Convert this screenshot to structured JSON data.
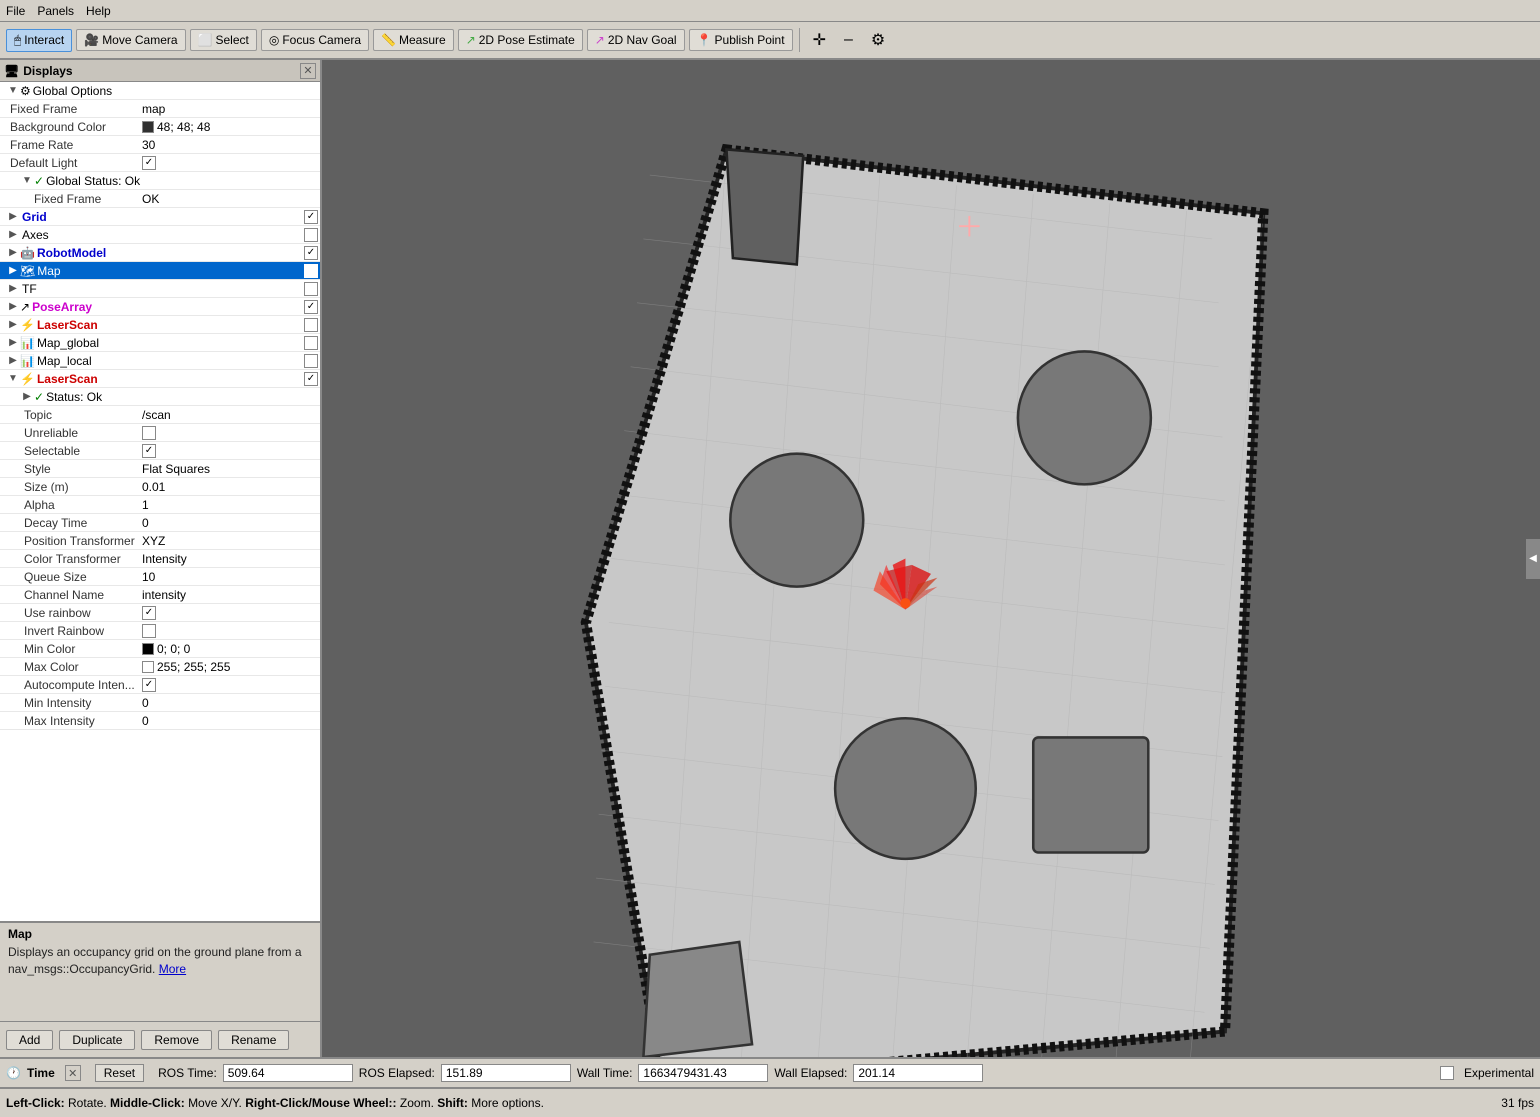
{
  "menubar": {
    "items": [
      "File",
      "Panels",
      "Help"
    ]
  },
  "toolbar": {
    "buttons": [
      {
        "id": "interact",
        "label": "Interact",
        "icon": "🖱",
        "active": true
      },
      {
        "id": "move-camera",
        "label": "Move Camera",
        "icon": "🎥",
        "active": false
      },
      {
        "id": "select",
        "label": "Select",
        "icon": "⬜",
        "active": false
      },
      {
        "id": "focus-camera",
        "label": "Focus Camera",
        "icon": "◎",
        "active": false
      },
      {
        "id": "measure",
        "label": "Measure",
        "icon": "📏",
        "active": false
      },
      {
        "id": "pose-estimate",
        "label": "2D Pose Estimate",
        "icon": "→",
        "active": false
      },
      {
        "id": "nav-goal",
        "label": "2D Nav Goal",
        "icon": "→",
        "active": false
      },
      {
        "id": "publish-point",
        "label": "Publish Point",
        "icon": "📍",
        "active": false
      }
    ]
  },
  "displays": {
    "header_title": "Displays",
    "tree": [
      {
        "id": "global-options",
        "label": "Global Options",
        "icon": "⚙",
        "level": 0,
        "expanded": true,
        "checkable": false
      },
      {
        "id": "fixed-frame-label",
        "label": "Fixed Frame",
        "value": "map",
        "level": 1,
        "is_prop": true
      },
      {
        "id": "bg-color-label",
        "label": "Background Color",
        "value": "48; 48; 48",
        "color": "dark",
        "level": 1,
        "is_prop": true
      },
      {
        "id": "frame-rate-label",
        "label": "Frame Rate",
        "value": "30",
        "level": 1,
        "is_prop": true
      },
      {
        "id": "default-light-label",
        "label": "Default Light",
        "value": "",
        "checked": true,
        "level": 1,
        "is_prop": true
      },
      {
        "id": "global-status",
        "label": "Global Status: Ok",
        "icon": "✓",
        "level": 1,
        "expanded": true,
        "checkable": false
      },
      {
        "id": "fixed-frame-status",
        "label": "Fixed Frame",
        "value": "OK",
        "level": 2,
        "is_prop": true
      },
      {
        "id": "grid",
        "label": "Grid",
        "level": 0,
        "expanded": false,
        "checkable": true,
        "checked": true,
        "color": "blue"
      },
      {
        "id": "axes",
        "label": "Axes",
        "level": 0,
        "expanded": false,
        "checkable": true,
        "checked": false
      },
      {
        "id": "robot-model",
        "label": "RobotModel",
        "level": 0,
        "expanded": false,
        "checkable": true,
        "checked": true,
        "color": "blue"
      },
      {
        "id": "map",
        "label": "Map",
        "level": 0,
        "expanded": false,
        "checkable": true,
        "checked": true,
        "selected": true
      },
      {
        "id": "tf",
        "label": "TF",
        "level": 0,
        "expanded": false,
        "checkable": true,
        "checked": false
      },
      {
        "id": "pose-array",
        "label": "PoseArray",
        "level": 0,
        "expanded": false,
        "checkable": true,
        "checked": true,
        "color": "pink"
      },
      {
        "id": "laser-scan-1",
        "label": "LaserScan",
        "level": 0,
        "expanded": false,
        "checkable": true,
        "checked": false,
        "color": "red"
      },
      {
        "id": "map-global",
        "label": "Map_global",
        "level": 0,
        "expanded": false,
        "checkable": true,
        "checked": false
      },
      {
        "id": "map-local",
        "label": "Map_local",
        "level": 0,
        "expanded": false,
        "checkable": true,
        "checked": false
      },
      {
        "id": "laser-scan-2",
        "label": "LaserScan",
        "level": 0,
        "expanded": true,
        "checkable": true,
        "checked": true,
        "color": "red"
      },
      {
        "id": "status-ok",
        "label": "Status: Ok",
        "icon": "✓",
        "level": 1,
        "expanded": false,
        "checkable": false
      },
      {
        "id": "topic-prop",
        "label": "Topic",
        "value": "/scan",
        "level": 1,
        "is_prop": true
      },
      {
        "id": "unreliable-prop",
        "label": "Unreliable",
        "value": "",
        "checked": false,
        "level": 1,
        "is_prop": true
      },
      {
        "id": "selectable-prop",
        "label": "Selectable",
        "value": "",
        "checked": true,
        "level": 1,
        "is_prop": true
      },
      {
        "id": "style-prop",
        "label": "Style",
        "value": "Flat Squares",
        "level": 1,
        "is_prop": true
      },
      {
        "id": "size-prop",
        "label": "Size (m)",
        "value": "0.01",
        "level": 1,
        "is_prop": true
      },
      {
        "id": "alpha-prop",
        "label": "Alpha",
        "value": "1",
        "level": 1,
        "is_prop": true
      },
      {
        "id": "decay-prop",
        "label": "Decay Time",
        "value": "0",
        "level": 1,
        "is_prop": true
      },
      {
        "id": "pos-transformer-prop",
        "label": "Position Transformer",
        "value": "XYZ",
        "level": 1,
        "is_prop": true
      },
      {
        "id": "color-transformer-prop",
        "label": "Color Transformer",
        "value": "Intensity",
        "level": 1,
        "is_prop": true
      },
      {
        "id": "queue-size-prop",
        "label": "Queue Size",
        "value": "10",
        "level": 1,
        "is_prop": true
      },
      {
        "id": "channel-name-prop",
        "label": "Channel Name",
        "value": "intensity",
        "level": 1,
        "is_prop": true
      },
      {
        "id": "use-rainbow-prop",
        "label": "Use rainbow",
        "value": "",
        "checked": true,
        "level": 1,
        "is_prop": true
      },
      {
        "id": "invert-rainbow-prop",
        "label": "Invert Rainbow",
        "value": "",
        "checked": false,
        "level": 1,
        "is_prop": true
      },
      {
        "id": "min-color-prop",
        "label": "Min Color",
        "value": "0; 0; 0",
        "color_box": "black",
        "level": 1,
        "is_prop": true
      },
      {
        "id": "max-color-prop",
        "label": "Max Color",
        "value": "255; 255; 255",
        "color_box": "white",
        "level": 1,
        "is_prop": true
      },
      {
        "id": "autocompute-prop",
        "label": "Autocompute Inten...",
        "value": "",
        "checked": true,
        "level": 1,
        "is_prop": true
      },
      {
        "id": "min-intensity-prop",
        "label": "Min Intensity",
        "value": "0",
        "level": 1,
        "is_prop": true
      },
      {
        "id": "max-intensity-prop",
        "label": "Max Intensity",
        "value": "0",
        "level": 1,
        "is_prop": true
      }
    ]
  },
  "info_panel": {
    "title": "Map",
    "description": "Displays an occupancy grid on the ground plane from a nav_msgs::OccupancyGrid.",
    "link_text": "More"
  },
  "buttons": {
    "add": "Add",
    "duplicate": "Duplicate",
    "remove": "Remove",
    "rename": "Rename"
  },
  "time_bar": {
    "title": "Time",
    "ros_time_label": "ROS Time:",
    "ros_time_value": "509.64",
    "ros_elapsed_label": "ROS Elapsed:",
    "ros_elapsed_value": "151.89",
    "wall_time_label": "Wall Time:",
    "wall_time_value": "1663479431.43",
    "wall_elapsed_label": "Wall Elapsed:",
    "wall_elapsed_value": "201.14",
    "experimental_label": "Experimental",
    "reset_label": "Reset"
  },
  "status_bar": {
    "hint": "Left-Click: Rotate.  Middle-Click: Move X/Y.  Right-Click/Mouse Wheel:: Zoom.  Shift: More options.",
    "fps": "31 fps",
    "hint_bold_parts": [
      "Left-Click:",
      "Middle-Click:",
      "Right-Click/Mouse Wheel::",
      "Shift:"
    ]
  }
}
